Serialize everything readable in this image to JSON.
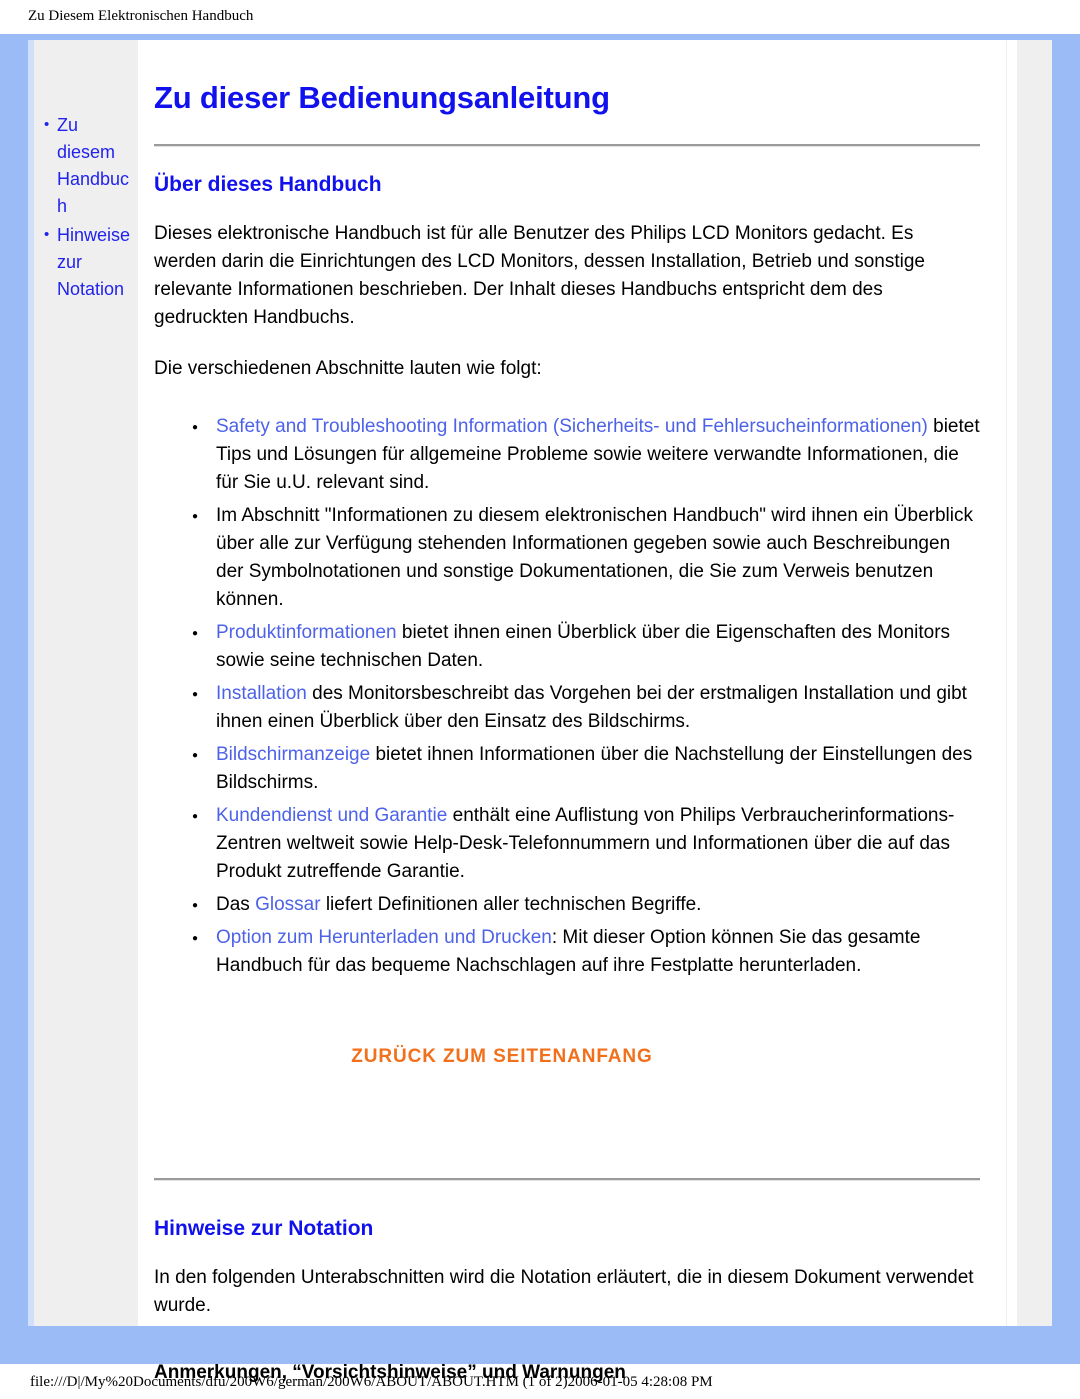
{
  "print_header": "Zu Diesem Elektronischen Handbuch",
  "print_footer": "file:///D|/My%20Documents/dfu/200W6/german/200W6/ABOUT/ABOUT.HTM (1 of 2)2006-01-05 4:28:08 PM",
  "colors": {
    "frame_blue": "#9bbbf7",
    "sidebar_bg": "#efefef",
    "heading_blue": "#1111ee",
    "link_blue": "#4d62e8",
    "nav_link_blue": "#2222ee",
    "back_to_top_orange": "#f2701b",
    "rule_gray": "#9a9a9a"
  },
  "sidebar": {
    "items": [
      {
        "label": "Zu diesem Handbuch"
      },
      {
        "label": "Hinweise zur Notation"
      }
    ]
  },
  "main": {
    "title": "Zu dieser Bedienungsanleitung",
    "section_about": {
      "heading": "Über dieses Handbuch",
      "paragraph_1": "Dieses elektronische Handbuch ist für alle Benutzer des Philips LCD Monitors gedacht. Es werden darin die Einrichtungen des LCD Monitors, dessen Installation, Betrieb und sonstige relevante Informationen beschrieben. Der Inhalt dieses Handbuchs entspricht dem des gedruckten Handbuchs.",
      "paragraph_2": "Die verschiedenen Abschnitte lauten wie folgt:",
      "bullets": [
        {
          "link": "Safety and Troubleshooting Information (Sicherheits- und Fehlersucheinformationen)",
          "text_before": "",
          "text_after": " bietet Tips und Lösungen für allgemeine Probleme sowie weitere verwandte Informationen, die für Sie u.U. relevant sind."
        },
        {
          "link": "",
          "text_before": "Im Abschnitt \"Informationen zu diesem elektronischen Handbuch\" wird ihnen ein Überblick über alle zur Verfügung stehenden Informationen gegeben sowie auch Beschreibungen der Symbolnotationen und sonstige Dokumentationen, die Sie zum Verweis benutzen können.",
          "text_after": ""
        },
        {
          "link": "Produktinformationen",
          "text_before": "",
          "text_after": " bietet ihnen einen Überblick über die Eigenschaften des Monitors sowie seine technischen Daten."
        },
        {
          "link": "Installation",
          "text_before": "",
          "text_after": " des Monitorsbeschreibt das Vorgehen bei der erstmaligen Installation und gibt ihnen einen Überblick über den Einsatz des Bildschirms."
        },
        {
          "link": "Bildschirmanzeige",
          "text_before": "",
          "text_after": " bietet ihnen Informationen über die Nachstellung der Einstellungen des Bildschirms."
        },
        {
          "link": "Kundendienst und Garantie",
          "text_before": "",
          "text_after": " enthält eine Auflistung von Philips Verbraucherinformations-Zentren weltweit sowie Help-Desk-Telefonnummern und Informationen über die auf das Produkt zutreffende Garantie."
        },
        {
          "link": "Glossar",
          "text_before": "Das ",
          "text_after": " liefert Definitionen aller technischen Begriffe."
        },
        {
          "link": "Option zum Herunterladen und Drucken",
          "text_before": "",
          "text_after": ": Mit dieser Option können Sie das gesamte Handbuch für das bequeme Nachschlagen auf ihre Festplatte herunterladen."
        }
      ],
      "back_to_top": "ZURÜCK ZUM SEITENANFANG"
    },
    "section_notation": {
      "heading": "Hinweise zur Notation",
      "paragraph_1": "In den folgenden Unterabschnitten wird die Notation erläutert, die in diesem Dokument verwendet wurde.",
      "sub_heading": "Anmerkungen, “Vorsichtshinweise” und Warnungen"
    }
  }
}
